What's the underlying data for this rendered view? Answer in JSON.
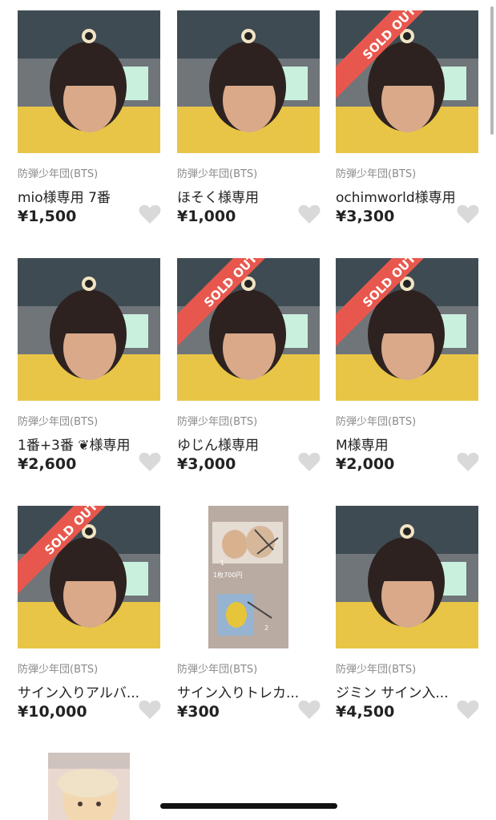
{
  "items": [
    {
      "brand": "防弾少年団(BTS)",
      "title": "mio様専用 7番",
      "price": "¥1,500",
      "sold": false,
      "image": "jimin"
    },
    {
      "brand": "防弾少年団(BTS)",
      "title": "ほそく様専用",
      "price": "¥1,000",
      "sold": false,
      "image": "jimin"
    },
    {
      "brand": "防弾少年団(BTS)",
      "title": "ochimworld様専用",
      "price": "¥3,300",
      "sold": true,
      "image": "jimin"
    },
    {
      "brand": "防弾少年団(BTS)",
      "title": "1番+3番 ❦様専用",
      "price": "¥2,600",
      "sold": false,
      "image": "jimin"
    },
    {
      "brand": "防弾少年団(BTS)",
      "title": "ゆじん様専用",
      "price": "¥3,000",
      "sold": true,
      "image": "jimin"
    },
    {
      "brand": "防弾少年団(BTS)",
      "title": "M様専用",
      "price": "¥2,000",
      "sold": true,
      "image": "jimin"
    },
    {
      "brand": "防弾少年団(BTS)",
      "title": "サイン入りアルバ...",
      "price": "¥10,000",
      "sold": true,
      "image": "jimin"
    },
    {
      "brand": "防弾少年団(BTS)",
      "title": "サイン入りトレカ...",
      "price": "¥300",
      "sold": false,
      "image": "photocards"
    },
    {
      "brand": "防弾少年団(BTS)",
      "title": "ジミン サイン入...",
      "price": "¥4,500",
      "sold": false,
      "image": "jimin"
    }
  ],
  "sold_label": "SOLD OUT",
  "photocard_labels": {
    "one": "1",
    "price_note": "1枚700円",
    "two": "2"
  },
  "colors": {
    "sold_band": "#e8574d",
    "heart": "#d9d9d9",
    "text": "#222222",
    "brand_text": "#8a8a8a"
  },
  "icons": {
    "like": "heart-outline-icon"
  }
}
